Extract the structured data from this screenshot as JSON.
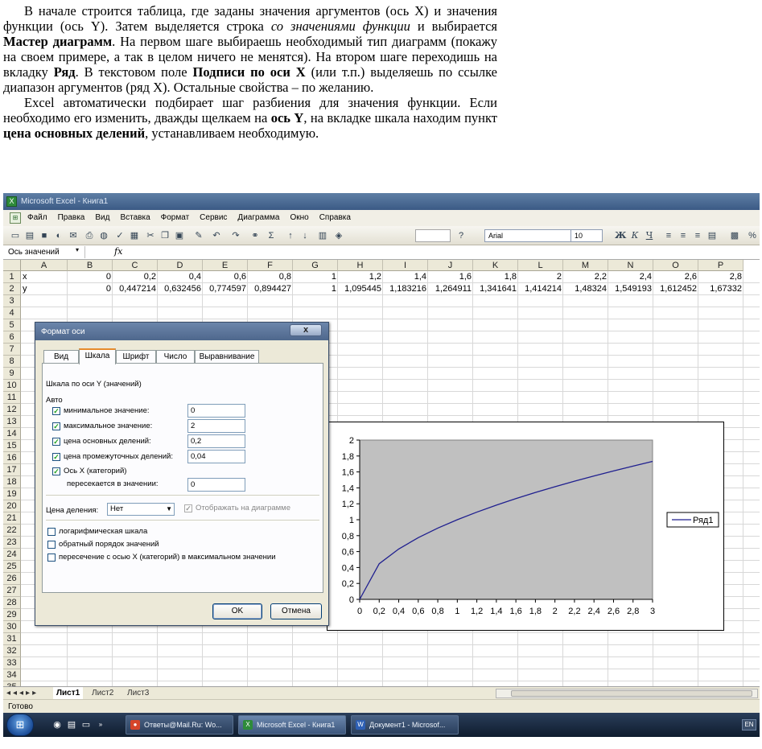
{
  "document": {
    "paragraph1": [
      {
        "t": "В начале строится таблица, где заданы значения аргументов (ось X) и значения функции (ось Y). Затем выделяется строка ",
        "s": "n"
      },
      {
        "t": "со значениями функции",
        "s": "i"
      },
      {
        "t": " и выбирается ",
        "s": "n"
      },
      {
        "t": "Мастер диаграмм",
        "s": "b"
      },
      {
        "t": ". На первом шаге выбираешь необходимый тип диаграмм (покажу на своем примере, а так в целом ничего не менятся). На втором шаге переходишь на вкладку ",
        "s": "n"
      },
      {
        "t": "Ряд",
        "s": "b"
      },
      {
        "t": ". В текстовом поле ",
        "s": "n"
      },
      {
        "t": "Подписи по оси Х",
        "s": "b"
      },
      {
        "t": " (или т.п.) выделяешь по ссылке диапазон аргументов (ряд Х). Остальные свойства – по желанию.",
        "s": "n"
      }
    ],
    "paragraph2": [
      {
        "t": "Excel автоматически подбирает шаг разбиения для значения функции. Если необходимо его изменить, дважды щелкаем на ",
        "s": "n"
      },
      {
        "t": "ось Y",
        "s": "b"
      },
      {
        "t": ", на вкладке шкала находим пункт ",
        "s": "n"
      },
      {
        "t": "цена основных делений",
        "s": "b"
      },
      {
        "t": ", устанавливаем необходимую.",
        "s": "n"
      }
    ]
  },
  "excel": {
    "title": "Microsoft Excel - Книга1",
    "menu": [
      "Файл",
      "Правка",
      "Вид",
      "Вставка",
      "Формат",
      "Сервис",
      "Диаграмма",
      "Окно",
      "Справка"
    ],
    "font_name": "Arial",
    "font_size": "10",
    "name_box": "Ось значений",
    "fx": "fx",
    "columns": [
      "A",
      "B",
      "C",
      "D",
      "E",
      "F",
      "G",
      "H",
      "I",
      "J",
      "K",
      "L",
      "M",
      "N",
      "O",
      "P"
    ],
    "row_numbers": [
      "1",
      "2",
      "3",
      "4",
      "5",
      "6",
      "7",
      "8",
      "9",
      "10",
      "11",
      "12",
      "13",
      "14",
      "15",
      "16",
      "17",
      "18",
      "19",
      "20",
      "21",
      "22",
      "23",
      "24",
      "25",
      "26",
      "27",
      "28",
      "29",
      "30",
      "31",
      "32",
      "33",
      "34",
      "35"
    ],
    "rows": [
      {
        "label": "x",
        "values": [
          "0",
          "0,2",
          "0,4",
          "0,6",
          "0,8",
          "1",
          "1,2",
          "1,4",
          "1,6",
          "1,8",
          "2",
          "2,2",
          "2,4",
          "2,6",
          "2,8"
        ]
      },
      {
        "label": "y",
        "values": [
          "0",
          "0,447214",
          "0,632456",
          "0,774597",
          "0,894427",
          "1",
          "1,095445",
          "1,183216",
          "1,264911",
          "1,341641",
          "1,414214",
          "1,48324",
          "1,549193",
          "1,612452",
          "1,67332"
        ]
      }
    ],
    "sheets": [
      "Лист1",
      "Лист2",
      "Лист3"
    ],
    "status": "Готово",
    "taskbar": [
      "Ответы@Mail.Ru: Wo...",
      "Microsoft Excel - Книга1",
      "Документ1 - Microsof..."
    ]
  },
  "dialog": {
    "title": "Формат оси",
    "close": "x",
    "tabs": [
      "Вид",
      "Шкала",
      "Шрифт",
      "Число",
      "Выравнивание"
    ],
    "active_tab": "Шкала",
    "heading": "Шкала по оси Y (значений)",
    "auto_label": "Авто",
    "fields": [
      {
        "label": "минимальное значение:",
        "value": "0",
        "checked": true
      },
      {
        "label": "максимальное значение:",
        "value": "2",
        "checked": true
      },
      {
        "label": "цена основных делений:",
        "value": "0,2",
        "checked": true
      },
      {
        "label": "цена промежуточных делений:",
        "value": "0,04",
        "checked": true
      }
    ],
    "axis_x_label": "Ось X (категорий)",
    "intersect_label": "пересекается в значении:",
    "intersect_value": "0",
    "units_label": "Цена деления:",
    "units_value": "Нет",
    "show_on_chart": "Отображать на диаграмме",
    "options": [
      "логарифмическая шкала",
      "обратный порядок значений",
      "пересечение с осью X (категорий) в максимальном значении"
    ],
    "ok": "OK",
    "cancel": "Отмена"
  },
  "chart_data": {
    "type": "line",
    "x": [
      "0",
      "0,2",
      "0,4",
      "0,6",
      "0,8",
      "1",
      "1,2",
      "1,4",
      "1,6",
      "1,8",
      "2",
      "2,2",
      "2,4",
      "2,6",
      "2,8",
      "3"
    ],
    "series": [
      {
        "name": "Ряд1",
        "values": [
          0,
          0.447214,
          0.632456,
          0.774597,
          0.894427,
          1,
          1.095445,
          1.183216,
          1.264911,
          1.341641,
          1.414214,
          1.48324,
          1.549193,
          1.612452,
          1.67332,
          1.732051
        ]
      }
    ],
    "yticks": [
      "0",
      "0,2",
      "0,4",
      "0,6",
      "0,8",
      "1",
      "1,2",
      "1,4",
      "1,6",
      "1,8",
      "2"
    ],
    "ylim": [
      0,
      2
    ],
    "plot_area_color": "#c0c0c0",
    "line_color": "#1f1f8f",
    "legend_position": "right",
    "grid": false
  }
}
